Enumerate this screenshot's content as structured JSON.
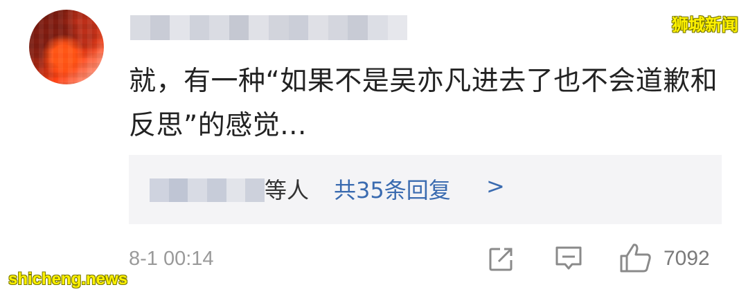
{
  "comment": {
    "text": "就，有一种“如果不是吴亦凡进去了也不会道歉和反思”的感觉...",
    "timestamp": "8-1 00:14",
    "like_count": "7092"
  },
  "replies": {
    "who_suffix": "等人",
    "count_label": "共35条回复",
    "arrow": ">"
  },
  "icons": {
    "avatar": "avatar",
    "share": "share-icon",
    "comment": "comment-icon",
    "like": "thumbs-up-icon"
  },
  "watermarks": {
    "top_right": "狮城新闻",
    "bottom_left": "shicheng.news"
  },
  "colors": {
    "link": "#3a6bb0",
    "text": "#222222",
    "meta": "#9a9a9a",
    "reply_bg": "#f4f4f6",
    "watermark": "#fff200"
  }
}
